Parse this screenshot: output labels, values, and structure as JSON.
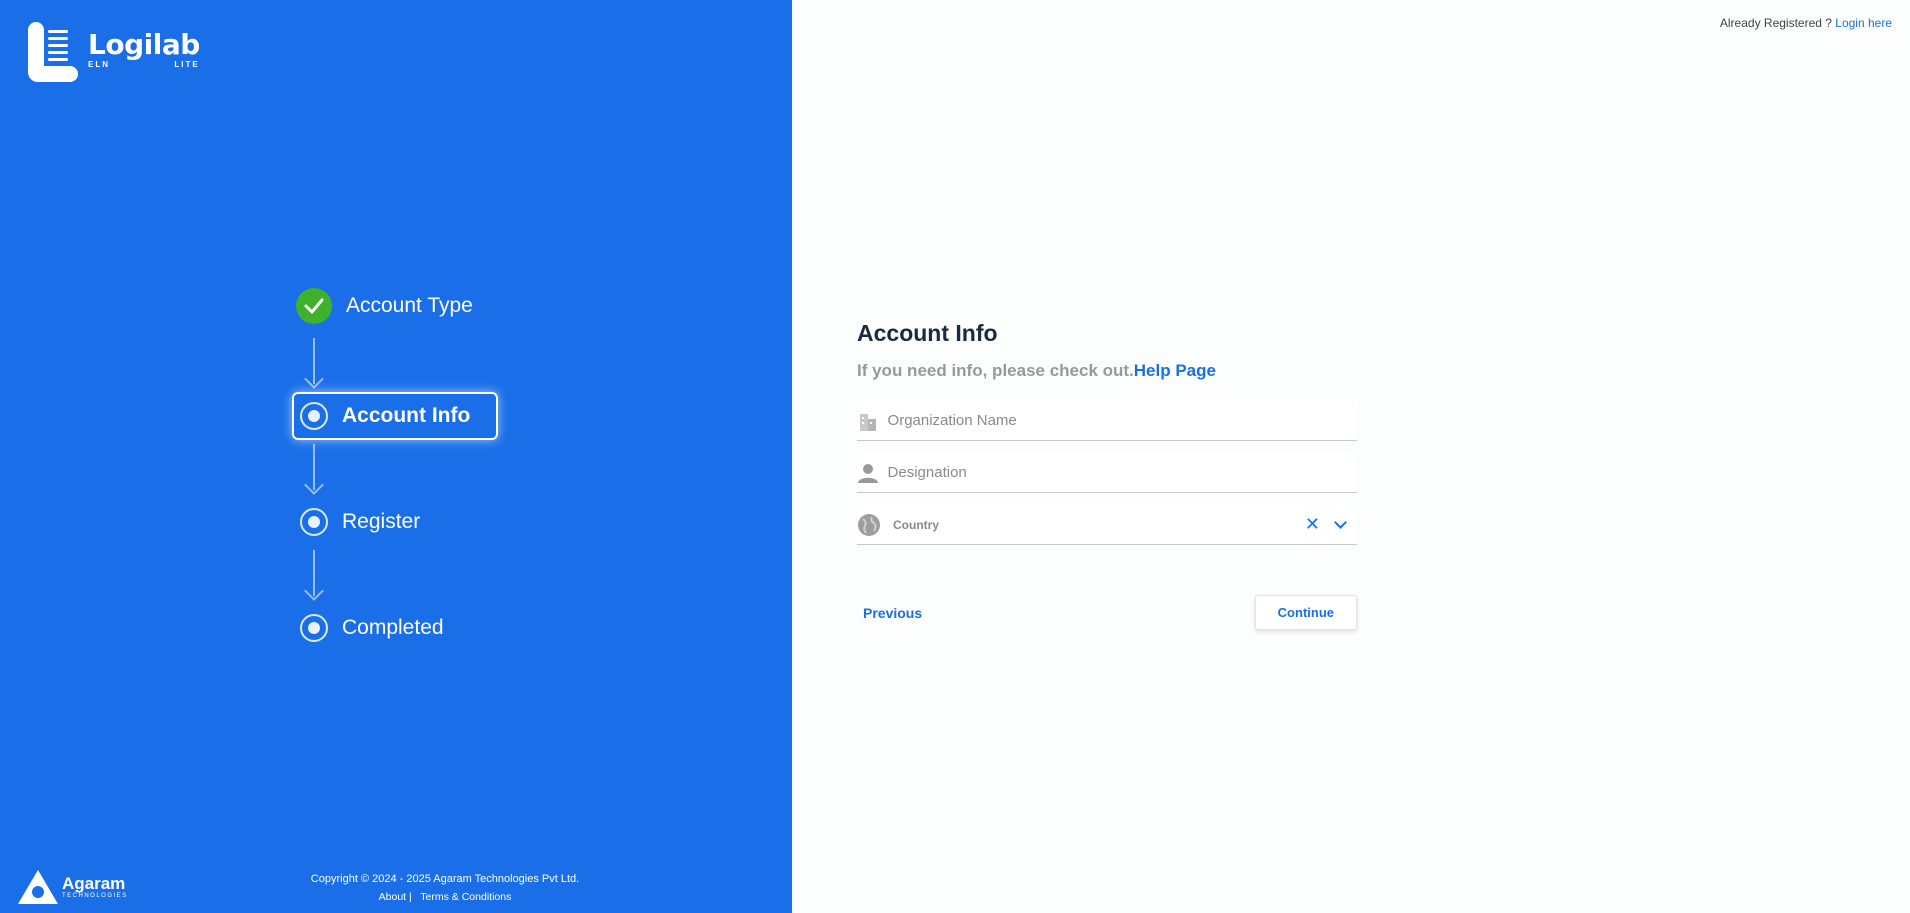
{
  "brand": {
    "name": "Logilab",
    "sub_left": "ELN",
    "sub_right": "LITE"
  },
  "steps": [
    {
      "label": "Account Type",
      "state": "completed",
      "icon": "check-icon"
    },
    {
      "label": "Account Info",
      "state": "active",
      "icon": "radio-icon"
    },
    {
      "label": "Register",
      "state": "pending",
      "icon": "radio-icon"
    },
    {
      "label": "Completed",
      "state": "pending",
      "icon": "radio-icon"
    }
  ],
  "company": {
    "name": "Agaram",
    "sub": "TECHNOLOGIES"
  },
  "footer": {
    "copyright": "Copyright © 2024 - 2025 Agaram Technologies Pvt Ltd.",
    "about": "About |",
    "terms": "Terms & Conditions"
  },
  "header": {
    "already_registered": "Already Registered ?",
    "login_link": "Login here"
  },
  "form": {
    "title": "Account Info",
    "help_text": "If you need info, please check out.",
    "help_link": "Help Page",
    "organization_placeholder": "Organization Name",
    "designation_placeholder": "Designation",
    "country_placeholder": "Country",
    "clear_symbol": "✕",
    "previous_label": "Previous",
    "continue_label": "Continue"
  },
  "colors": {
    "primary": "#1a6fe8",
    "success": "#3fb12a",
    "background": "#fcfdfd"
  }
}
